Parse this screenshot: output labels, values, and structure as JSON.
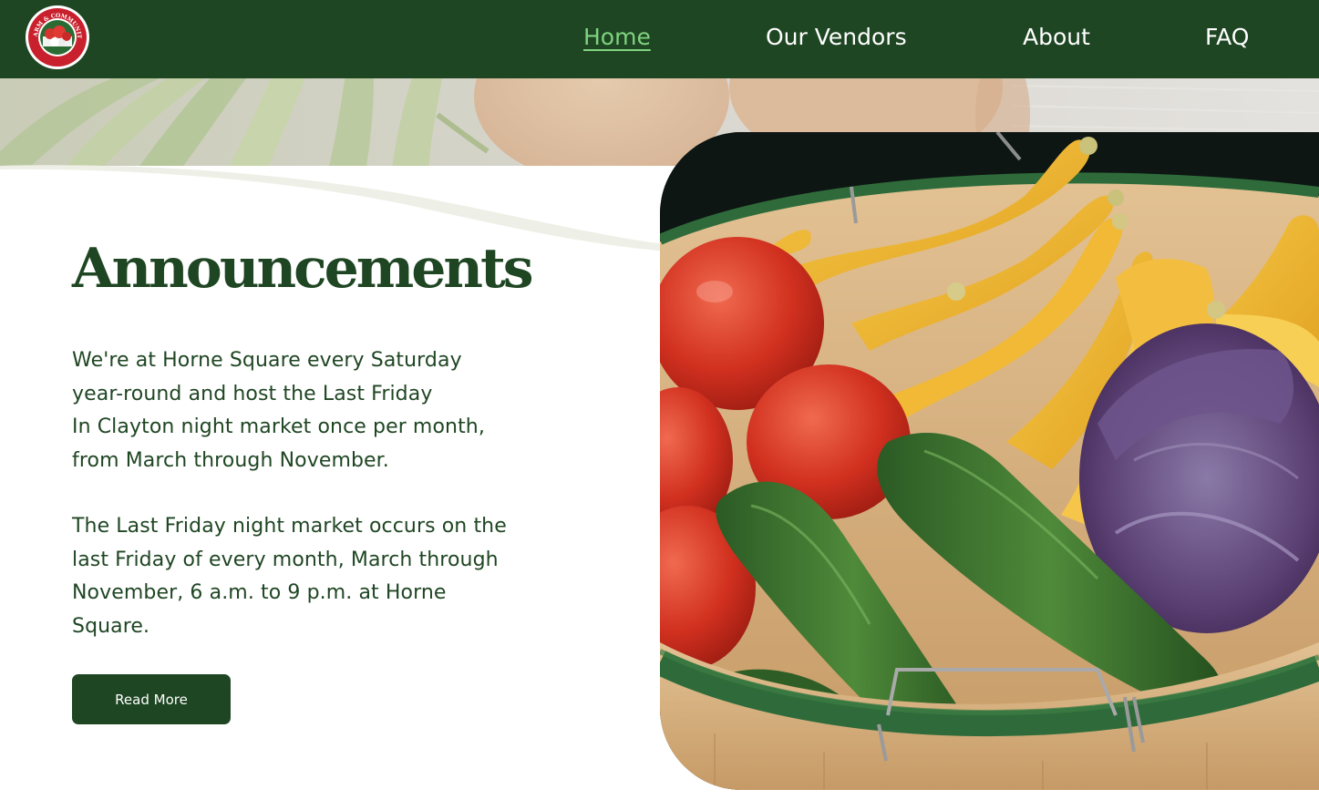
{
  "header": {
    "logo_text": "CLAYTON FARM & COMMUNITY MARKET",
    "nav": [
      {
        "label": "Home",
        "active": true
      },
      {
        "label": "Our Vendors",
        "active": false
      },
      {
        "label": "About",
        "active": false
      },
      {
        "label": "FAQ",
        "active": false
      }
    ]
  },
  "main": {
    "heading": "Announcements",
    "paragraph1_lines": [
      "We're at Horne Square every Saturday",
      "year-round and host the Last Friday",
      "In Clayton night market once per month,",
      "from March through November."
    ],
    "paragraph2_lines": [
      "The Last Friday night market occurs on the",
      "last Friday of every month, March through",
      "November, 6 a.m. to 9 p.m. at Horne",
      "Square."
    ],
    "button_label": "Read More"
  },
  "colors": {
    "brand_green": "#1f4623",
    "active_nav": "#7fd37f",
    "background": "#ffffff"
  }
}
